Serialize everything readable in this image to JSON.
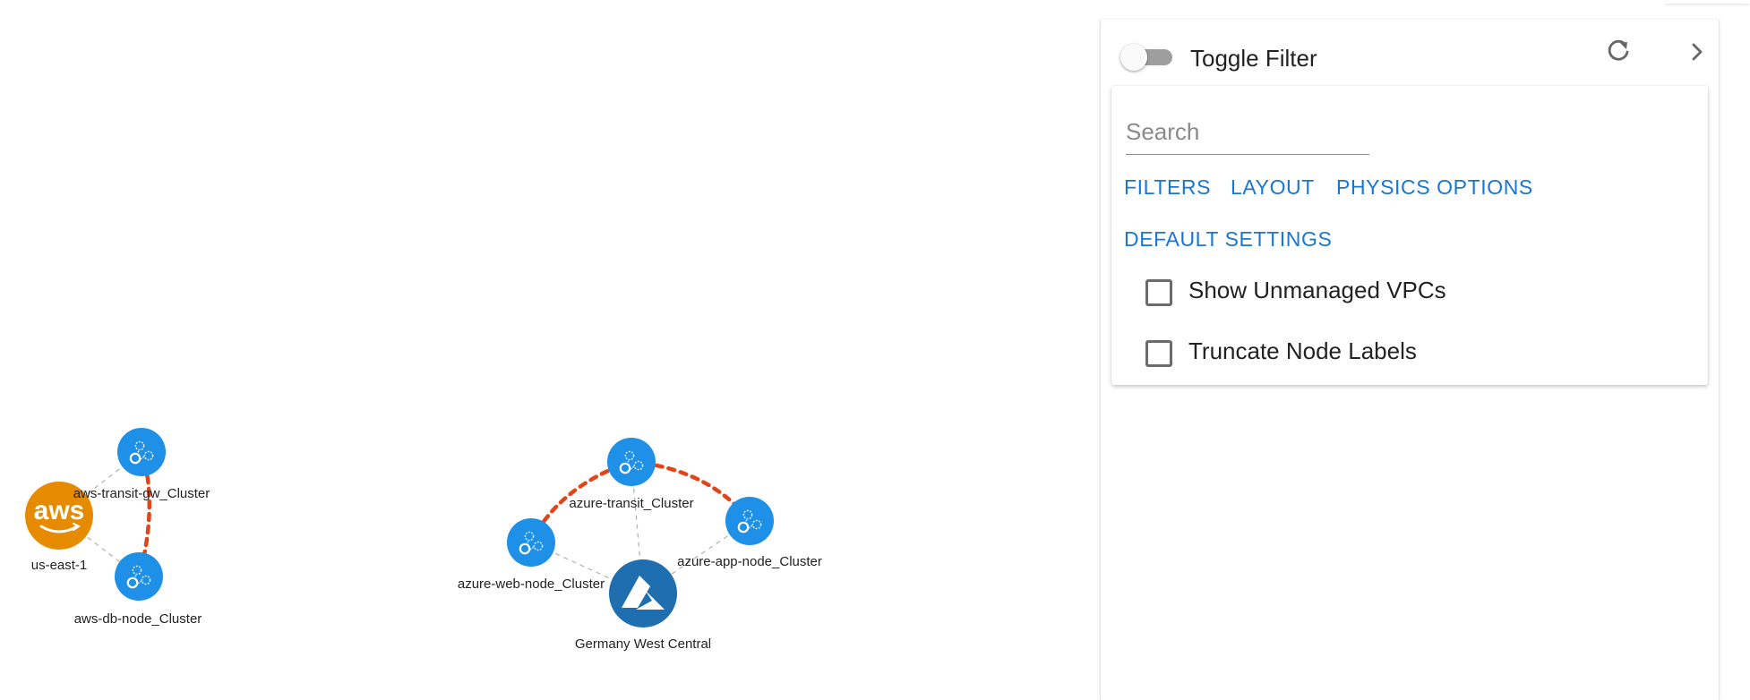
{
  "graph": {
    "nodes": [
      {
        "id": "aws_region",
        "label": "us-east-1",
        "kind": "aws-provider"
      },
      {
        "id": "aws_transit",
        "label": "aws-transit-gw_Cluster",
        "kind": "cluster"
      },
      {
        "id": "aws_db",
        "label": "aws-db-node_Cluster",
        "kind": "cluster"
      },
      {
        "id": "azure_transit",
        "label": "azure-transit_Cluster",
        "kind": "cluster"
      },
      {
        "id": "azure_web",
        "label": "azure-web-node_Cluster",
        "kind": "cluster"
      },
      {
        "id": "azure_app",
        "label": "azure-app-node_Cluster",
        "kind": "cluster"
      },
      {
        "id": "azure_region",
        "label": "Germany West Central",
        "kind": "azure-provider"
      }
    ],
    "aws_logo_text": "aws",
    "colors": {
      "cluster_node": "#1e90e8",
      "aws_node": "#e68a00",
      "azure_node": "#1f6fb0",
      "peering_edge": "#e0461a",
      "link_edge": "#b0b0b0"
    }
  },
  "panel": {
    "toggle_label": "Toggle Filter",
    "toggle_on": false,
    "refresh_icon": "refresh-icon",
    "collapse_icon": "chevron-right-icon",
    "search_placeholder": "Search",
    "tabs": {
      "filters": "FILTERS",
      "layout": "LAYOUT",
      "physics": "PHYSICS OPTIONS",
      "defaults": "DEFAULT SETTINGS"
    },
    "options": {
      "unmanaged": "Show Unmanaged VPCs",
      "truncate": "Truncate Node Labels"
    },
    "accent_color": "#1976d2"
  }
}
